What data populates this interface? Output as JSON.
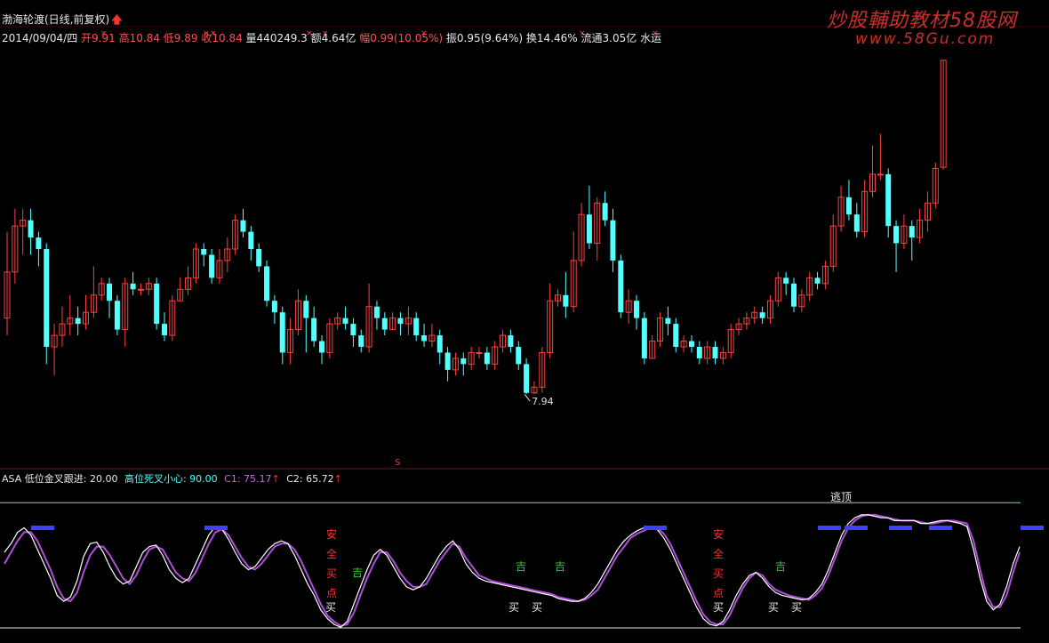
{
  "header": {
    "name": "渤海轮渡(日线,前复权)",
    "date": "2014/09/04/四",
    "open": "开9.91",
    "high": "高10.84",
    "low": "低9.89",
    "close": "收10.84",
    "volume": "量440249.3",
    "amount": "额4.64亿",
    "change": "幅0.99(10.05%)",
    "amplitude": "振0.95(9.64%)",
    "turnover": "换14.46%",
    "float_cap": "流通3.05亿",
    "sector": "水运"
  },
  "watermark": {
    "title": "炒股輔助教材58股网",
    "url": "www.58Gu.com"
  },
  "indicator": {
    "name": "ASA",
    "low_cross_label": "低位金叉跟进: 20.00",
    "high_cross_label": "高位死叉小心: 90.00",
    "c1": "C1: 75.17",
    "c2": "C2: 65.72"
  },
  "colors": {
    "up": "#ff4040",
    "down": "#54ffff",
    "c1_line": "#ffffff",
    "c2_line": "#b14cdc",
    "header_red": "#ff5050",
    "level_line": "#7fd4c8",
    "green_sig": "#32cd32",
    "blue_sig": "#4040ff"
  },
  "chart_data": {
    "type": "candlestick",
    "price_axis_range": [
      7.5,
      10.9
    ],
    "min_label": "7.94",
    "s_marker": "S",
    "candles": [
      [
        8.6,
        9.0,
        9.35,
        8.45
      ],
      [
        9.0,
        9.4,
        9.55,
        8.9
      ],
      [
        9.4,
        9.45,
        9.55,
        9.15
      ],
      [
        9.45,
        9.3,
        9.55,
        9.15
      ],
      [
        9.3,
        9.2,
        9.35,
        9.05
      ],
      [
        9.2,
        8.35,
        9.25,
        8.2
      ],
      [
        8.35,
        8.45,
        8.55,
        8.1
      ],
      [
        8.45,
        8.55,
        8.7,
        8.35
      ],
      [
        8.55,
        8.6,
        8.8,
        8.45
      ],
      [
        8.6,
        8.55,
        8.7,
        8.45
      ],
      [
        8.55,
        8.65,
        8.8,
        8.5
      ],
      [
        8.65,
        8.8,
        9.05,
        8.6
      ],
      [
        8.8,
        8.9,
        8.95,
        8.75
      ],
      [
        8.9,
        8.75,
        8.95,
        8.6
      ],
      [
        8.75,
        8.5,
        8.8,
        8.45
      ],
      [
        8.5,
        8.9,
        8.95,
        8.35
      ],
      [
        8.9,
        8.85,
        9.0,
        8.8
      ],
      [
        8.85,
        8.85,
        8.9,
        8.8
      ],
      [
        8.85,
        8.9,
        8.95,
        8.8
      ],
      [
        8.9,
        8.55,
        8.95,
        8.5
      ],
      [
        8.55,
        8.45,
        8.65,
        8.4
      ],
      [
        8.45,
        8.75,
        8.8,
        8.4
      ],
      [
        8.75,
        8.85,
        8.95,
        8.75
      ],
      [
        8.85,
        8.95,
        9.05,
        8.8
      ],
      [
        8.95,
        9.2,
        9.25,
        8.9
      ],
      [
        9.2,
        9.15,
        9.25,
        9.05
      ],
      [
        9.15,
        8.95,
        9.2,
        8.9
      ],
      [
        8.95,
        9.1,
        9.2,
        8.9
      ],
      [
        9.1,
        9.2,
        9.3,
        9.0
      ],
      [
        9.2,
        9.45,
        9.5,
        9.15
      ],
      [
        9.45,
        9.35,
        9.55,
        9.3
      ],
      [
        9.35,
        9.2,
        9.4,
        9.1
      ],
      [
        9.2,
        9.05,
        9.25,
        9.0
      ],
      [
        9.05,
        8.75,
        9.1,
        8.7
      ],
      [
        8.75,
        8.65,
        8.8,
        8.55
      ],
      [
        8.65,
        8.3,
        8.7,
        8.2
      ],
      [
        8.3,
        8.5,
        8.6,
        8.2
      ],
      [
        8.5,
        8.75,
        8.85,
        8.45
      ],
      [
        8.75,
        8.6,
        8.8,
        8.3
      ],
      [
        8.6,
        8.4,
        8.7,
        8.35
      ],
      [
        8.4,
        8.3,
        8.45,
        8.2
      ],
      [
        8.3,
        8.55,
        8.6,
        8.25
      ],
      [
        8.55,
        8.6,
        8.65,
        8.5
      ],
      [
        8.6,
        8.55,
        8.7,
        8.5
      ],
      [
        8.55,
        8.45,
        8.6,
        8.35
      ],
      [
        8.45,
        8.35,
        8.5,
        8.3
      ],
      [
        8.35,
        8.7,
        8.9,
        8.3
      ],
      [
        8.7,
        8.6,
        8.75,
        8.5
      ],
      [
        8.6,
        8.5,
        8.65,
        8.45
      ],
      [
        8.5,
        8.6,
        8.65,
        8.5
      ],
      [
        8.6,
        8.55,
        8.65,
        8.45
      ],
      [
        8.55,
        8.6,
        8.7,
        8.45
      ],
      [
        8.6,
        8.45,
        8.65,
        8.4
      ],
      [
        8.45,
        8.4,
        8.55,
        8.35
      ],
      [
        8.4,
        8.45,
        8.55,
        8.35
      ],
      [
        8.45,
        8.3,
        8.5,
        8.2
      ],
      [
        8.3,
        8.15,
        8.35,
        8.05
      ],
      [
        8.15,
        8.25,
        8.3,
        8.1
      ],
      [
        8.25,
        8.2,
        8.3,
        8.1
      ],
      [
        8.2,
        8.3,
        8.35,
        8.15
      ],
      [
        8.3,
        8.3,
        8.35,
        8.25
      ],
      [
        8.3,
        8.2,
        8.35,
        8.15
      ],
      [
        8.2,
        8.35,
        8.4,
        8.15
      ],
      [
        8.35,
        8.45,
        8.5,
        8.3
      ],
      [
        8.45,
        8.35,
        8.5,
        8.3
      ],
      [
        8.35,
        8.2,
        8.4,
        8.15
      ],
      [
        8.2,
        7.95,
        8.25,
        7.94
      ],
      [
        7.95,
        8.0,
        8.05,
        7.94
      ],
      [
        8.0,
        8.3,
        8.35,
        7.95
      ],
      [
        8.3,
        8.75,
        8.9,
        8.25
      ],
      [
        8.75,
        8.8,
        8.85,
        8.7
      ],
      [
        8.8,
        8.7,
        9.0,
        8.6
      ],
      [
        8.7,
        9.1,
        9.35,
        8.65
      ],
      [
        9.1,
        9.5,
        9.6,
        9.05
      ],
      [
        9.5,
        9.25,
        9.75,
        9.2
      ],
      [
        9.25,
        9.6,
        9.65,
        9.1
      ],
      [
        9.6,
        9.45,
        9.7,
        9.4
      ],
      [
        9.45,
        9.1,
        9.55,
        9.0
      ],
      [
        9.1,
        8.65,
        9.15,
        8.6
      ],
      [
        8.65,
        8.75,
        8.85,
        8.55
      ],
      [
        8.75,
        8.6,
        8.8,
        8.5
      ],
      [
        8.6,
        8.25,
        8.65,
        8.2
      ],
      [
        8.25,
        8.4,
        8.45,
        8.25
      ],
      [
        8.4,
        8.6,
        8.65,
        8.35
      ],
      [
        8.6,
        8.55,
        8.7,
        8.45
      ],
      [
        8.55,
        8.35,
        8.6,
        8.3
      ],
      [
        8.35,
        8.4,
        8.45,
        8.3
      ],
      [
        8.4,
        8.35,
        8.45,
        8.3
      ],
      [
        8.35,
        8.25,
        8.4,
        8.2
      ],
      [
        8.25,
        8.35,
        8.4,
        8.2
      ],
      [
        8.35,
        8.25,
        8.4,
        8.2
      ],
      [
        8.25,
        8.3,
        8.35,
        8.2
      ],
      [
        8.3,
        8.5,
        8.55,
        8.25
      ],
      [
        8.5,
        8.55,
        8.6,
        8.45
      ],
      [
        8.55,
        8.6,
        8.65,
        8.5
      ],
      [
        8.6,
        8.65,
        8.7,
        8.55
      ],
      [
        8.65,
        8.6,
        8.7,
        8.55
      ],
      [
        8.6,
        8.75,
        8.8,
        8.55
      ],
      [
        8.75,
        8.95,
        9.0,
        8.7
      ],
      [
        8.95,
        8.9,
        9.0,
        8.8
      ],
      [
        8.9,
        8.7,
        8.95,
        8.65
      ],
      [
        8.7,
        8.8,
        8.85,
        8.65
      ],
      [
        8.8,
        8.95,
        9.0,
        8.75
      ],
      [
        8.95,
        8.9,
        9.0,
        8.85
      ],
      [
        8.9,
        9.05,
        9.1,
        8.85
      ],
      [
        9.05,
        9.4,
        9.5,
        9.0
      ],
      [
        9.4,
        9.65,
        9.75,
        9.35
      ],
      [
        9.65,
        9.5,
        9.8,
        9.45
      ],
      [
        9.5,
        9.35,
        9.6,
        9.3
      ],
      [
        9.35,
        9.7,
        9.8,
        9.3
      ],
      [
        9.7,
        9.85,
        10.1,
        9.65
      ],
      [
        9.85,
        9.85,
        10.2,
        9.8
      ],
      [
        9.85,
        9.4,
        9.9,
        9.3
      ],
      [
        9.4,
        9.25,
        9.45,
        9.0
      ],
      [
        9.25,
        9.4,
        9.5,
        9.2
      ],
      [
        9.4,
        9.3,
        9.45,
        9.1
      ],
      [
        9.3,
        9.45,
        9.55,
        9.25
      ],
      [
        9.45,
        9.6,
        9.7,
        9.35
      ],
      [
        9.6,
        9.9,
        9.95,
        9.55
      ],
      [
        9.91,
        10.84,
        10.84,
        9.89
      ]
    ]
  },
  "indicator_chart": {
    "range": [
      0,
      100
    ],
    "level_high": 90,
    "level_low": 20,
    "c1": [
      58,
      64,
      72,
      75,
      70,
      60,
      50,
      40,
      28,
      24,
      27,
      38,
      55,
      64,
      65,
      58,
      48,
      40,
      36,
      38,
      48,
      58,
      62,
      63,
      56,
      46,
      40,
      37,
      40,
      50,
      60,
      70,
      76,
      74,
      67,
      58,
      50,
      46,
      48,
      54,
      60,
      64,
      66,
      64,
      56,
      46,
      36,
      28,
      18,
      12,
      8,
      6,
      10,
      22,
      34,
      46,
      56,
      60,
      56,
      48,
      40,
      34,
      32,
      34,
      40,
      48,
      56,
      62,
      66,
      60,
      50,
      44,
      40,
      38,
      37,
      36,
      35,
      34,
      33,
      32,
      31,
      30,
      29,
      28,
      26,
      25,
      24,
      24,
      26,
      30,
      36,
      44,
      52,
      60,
      66,
      70,
      73,
      75,
      76,
      74,
      68,
      60,
      50,
      40,
      30,
      20,
      12,
      8,
      7,
      10,
      18,
      28,
      36,
      42,
      44,
      40,
      34,
      30,
      28,
      27,
      26,
      25,
      26,
      30,
      36,
      46,
      58,
      70,
      78,
      82,
      84,
      84,
      83,
      82,
      82,
      80,
      80,
      80,
      80,
      78,
      78,
      79,
      80,
      80,
      79,
      78,
      76,
      60,
      40,
      24,
      18,
      22,
      34,
      50,
      62
    ],
    "c2": [
      50,
      58,
      66,
      72,
      72,
      66,
      56,
      46,
      34,
      26,
      24,
      30,
      44,
      56,
      62,
      62,
      56,
      48,
      40,
      36,
      42,
      52,
      60,
      62,
      60,
      52,
      44,
      40,
      38,
      44,
      54,
      64,
      72,
      74,
      70,
      62,
      54,
      48,
      46,
      50,
      56,
      62,
      64,
      64,
      60,
      52,
      42,
      32,
      22,
      14,
      10,
      7,
      8,
      16,
      28,
      40,
      50,
      58,
      58,
      52,
      44,
      38,
      34,
      34,
      36,
      44,
      52,
      58,
      64,
      62,
      54,
      48,
      42,
      40,
      38,
      37,
      36,
      35,
      34,
      33,
      32,
      31,
      30,
      29,
      27,
      26,
      25,
      24,
      25,
      28,
      32,
      40,
      48,
      56,
      62,
      68,
      71,
      73,
      75,
      75,
      71,
      64,
      54,
      44,
      34,
      24,
      15,
      10,
      8,
      8,
      14,
      24,
      33,
      40,
      44,
      42,
      36,
      32,
      30,
      28,
      27,
      26,
      25,
      28,
      33,
      42,
      54,
      66,
      75,
      80,
      83,
      84,
      84,
      83,
      82,
      81,
      80,
      80,
      80,
      79,
      78,
      78,
      79,
      80,
      80,
      79,
      78,
      66,
      46,
      28,
      20,
      20,
      28,
      44,
      58
    ],
    "level_top_label": "逃顶",
    "buy_label": "买",
    "safe_buy_chars": [
      "安",
      "全",
      "买",
      "点"
    ],
    "green_sig_char": "吉"
  }
}
